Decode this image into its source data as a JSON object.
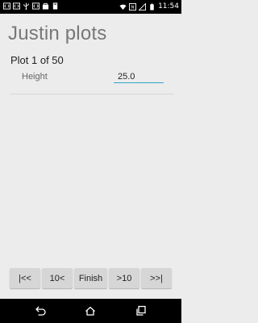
{
  "status_bar": {
    "time": "11:54",
    "left_icons": [
      "code-icon",
      "code-icon",
      "usb-icon",
      "code-icon",
      "shopping-bag-icon",
      "sd-card-icon"
    ],
    "right_icons": [
      "wifi-icon",
      "nfc-icon",
      "signal-icon",
      "battery-icon"
    ]
  },
  "app": {
    "title": "Justin plots"
  },
  "plot": {
    "label": "Plot 1 of 50"
  },
  "field": {
    "label": "Height",
    "value": "25.0"
  },
  "buttons": {
    "first": "|<<",
    "back10": "10<",
    "finish": "Finish",
    "forward10": ">10",
    "last": ">>|"
  },
  "nav_bar": {
    "icons": [
      "back-icon",
      "home-icon",
      "recent-apps-icon"
    ]
  },
  "colors": {
    "accent": "#2fa5c8",
    "background": "#ececec"
  }
}
